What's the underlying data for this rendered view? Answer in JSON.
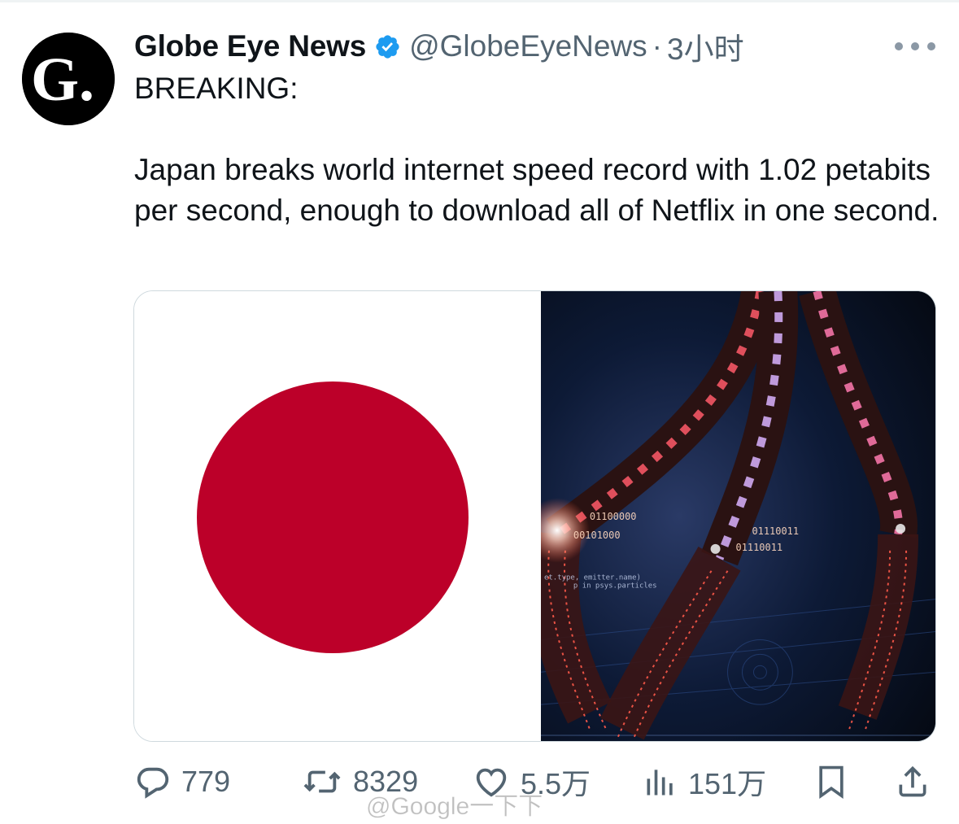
{
  "tweet": {
    "author": {
      "name": "Globe Eye News",
      "handle": "@GlobeEyeNews",
      "time": "3小时",
      "separator": "·",
      "avatar_letter": "G.",
      "verified": true
    },
    "text": {
      "line1": "BREAKING:",
      "body": "Japan breaks world internet speed record with 1.02 petabits per second, enough to download all of Netflix in one second."
    },
    "media": {
      "left": "japan-flag",
      "right": "fiber-optic-cables-illustration",
      "binary_labels": [
        "00101000",
        "01100000",
        "01110011",
        "01110011"
      ],
      "code_labels": [
        "et.type, emitter.name)",
        "p in psys.particles"
      ]
    },
    "actions": {
      "replies": "779",
      "reposts": "8329",
      "likes": "5.5万",
      "views": "151万"
    },
    "icons": {
      "reply": "speech-bubble-icon",
      "repost": "repost-arrows-icon",
      "like": "heart-icon",
      "views": "bar-chart-icon",
      "bookmark": "bookmark-icon",
      "share": "share-icon",
      "more": "more-dots-icon"
    },
    "colors": {
      "text": "#0f1419",
      "muted": "#536471",
      "verified": "#1d9bf0",
      "flag_red": "#bc0029"
    }
  },
  "watermark": "@Google一下下"
}
